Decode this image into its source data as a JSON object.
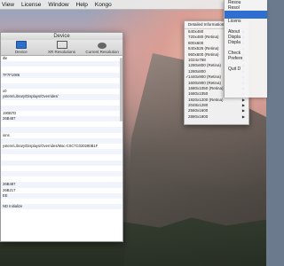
{
  "menubar": {
    "items": [
      "View",
      "License",
      "Window",
      "Help",
      "Kongo"
    ]
  },
  "window": {
    "title": "Device",
    "toolbar": {
      "buttons": [
        "Device",
        "XR Resolutions",
        "Current Resolution"
      ],
      "icons": [
        "display-icon",
        "resolution-icon",
        "eye-icon"
      ]
    },
    "rows": [
      "itle",
      "",
      "",
      "7F7F1086",
      "",
      "",
      "x0",
      "ystem/Library/Displays/Overrides/",
      "",
      "",
      "190B7D",
      "26B487",
      "",
      "",
      "ions",
      "",
      "ystem/Library/Displays/Overrides/Mac-C0C7C020280B1F",
      "",
      "",
      "",
      "",
      "",
      "",
      "26B487",
      "26B217",
      "EE",
      "",
      "ND Initialize",
      ""
    ]
  },
  "context_menu": {
    "header": "Detailed Information",
    "items": [
      "640x480",
      "720x480 (Retina)",
      "800x600",
      "840x525 (Retina)",
      "960x600 (Retina)",
      "1024x768",
      "1280x800 (Retina)",
      "1280x800",
      "1440x900 (Retina)",
      "1600x900 (Retina)",
      "1680x1050 (Retina)",
      "1680x1050",
      "1920x1200 (Retina)",
      "2048x1280",
      "2560x1600",
      "2880x1800"
    ],
    "checked_index": 8
  },
  "status_panel": {
    "items": [
      "Resou",
      "Resol",
      "",
      "Licens",
      "",
      "About",
      "Displa",
      "Displa",
      "",
      "Check",
      "Prefere",
      "",
      "Quit D"
    ]
  },
  "colors": {
    "accent": "#2f6fd1",
    "menubar_bg": "#ececec",
    "window_bg": "#ffffff"
  }
}
